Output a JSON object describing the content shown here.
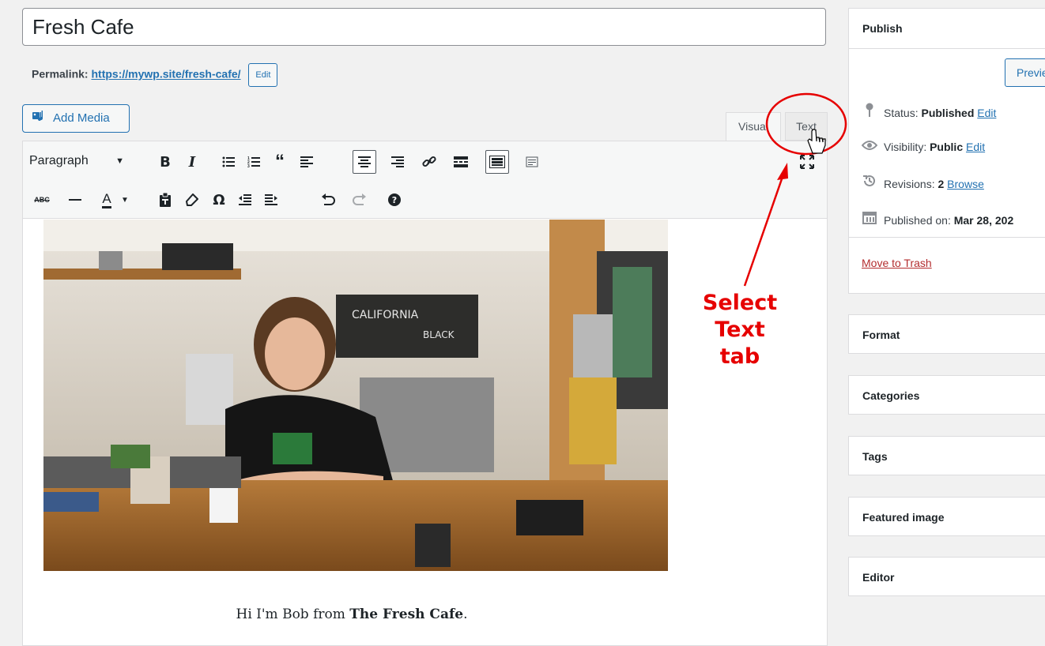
{
  "post": {
    "title": "Fresh Cafe",
    "permalink_label": "Permalink:",
    "permalink_url": "https://mywp.site/fresh-cafe/",
    "permalink_edit": "Edit"
  },
  "editor": {
    "add_media_label": "Add Media",
    "tab_visual": "Visual",
    "tab_text": "Text",
    "format_select_value": "Paragraph",
    "content_intro": "Hi I'm Bob from ",
    "content_bold": "The Fresh Cafe",
    "content_end": "."
  },
  "sidebar": {
    "publish": {
      "title": "Publish",
      "preview_label": "Preview",
      "status_label": "Status:",
      "status_value": "Published",
      "status_edit": "Edit",
      "visibility_label": "Visibility:",
      "visibility_value": "Public",
      "visibility_edit": "Edit",
      "revisions_label": "Revisions:",
      "revisions_count": "2",
      "revisions_browse": "Browse",
      "published_on_label": "Published on:",
      "published_on_value": "Mar 28, 202",
      "trash_label": "Move to Trash"
    },
    "panels": [
      "Format",
      "Categories",
      "Tags",
      "Featured image",
      "Editor"
    ]
  },
  "annotation": {
    "line1": "Select",
    "line2": "Text tab",
    "color": "#e60000"
  },
  "colors": {
    "accent": "#2271b1",
    "trash": "#b32d2e",
    "background": "#f1f1f1"
  }
}
